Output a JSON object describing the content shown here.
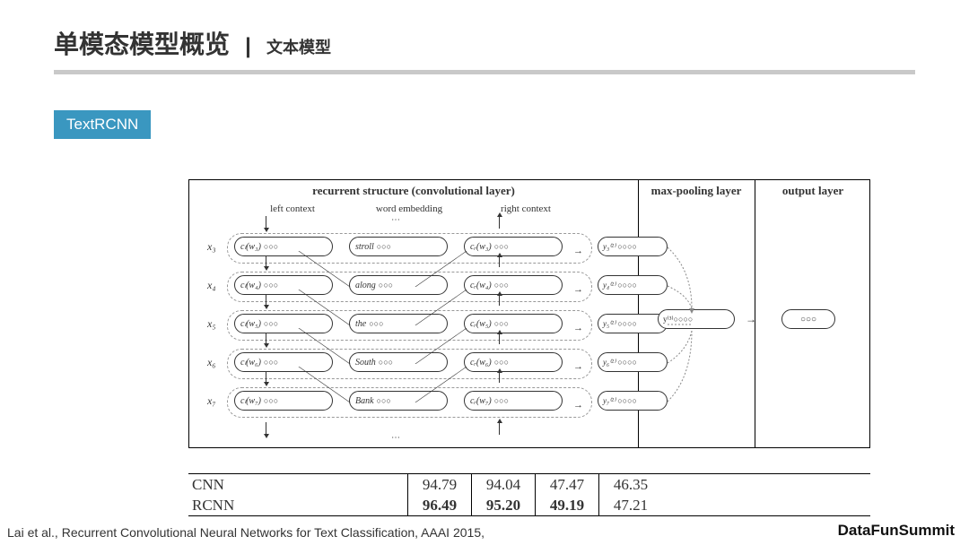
{
  "title": {
    "main": "单模态模型概览",
    "sub": "文本模型"
  },
  "badge": "TextRCNN",
  "figure": {
    "headers": {
      "recurrent": "recurrent structure (convolutional layer)",
      "pool": "max-pooling layer",
      "output": "output layer"
    },
    "subheads": {
      "left": "left context",
      "word": "word embedding",
      "right": "right context"
    },
    "pool_label": "y⁽³⁾",
    "rows": [
      {
        "x": "x₃",
        "cl": "cₗ(w₃)",
        "w": "stroll",
        "cr": "cᵣ(w₃)",
        "y": "y₃⁽²⁾"
      },
      {
        "x": "x₄",
        "cl": "cₗ(w₄)",
        "w": "along",
        "cr": "cᵣ(w₄)",
        "y": "y₄⁽²⁾"
      },
      {
        "x": "x₅",
        "cl": "cₗ(w₅)",
        "w": "the",
        "cr": "cᵣ(w₅)",
        "y": "y₅⁽²⁾"
      },
      {
        "x": "x₆",
        "cl": "cₗ(w₆)",
        "w": "South",
        "cr": "cᵣ(w₆)",
        "y": "y₆⁽²⁾"
      },
      {
        "x": "x₇",
        "cl": "cₗ(w₇)",
        "w": "Bank",
        "cr": "cᵣ(w₇)",
        "y": "y₇⁽²⁾"
      }
    ]
  },
  "table": {
    "rows": [
      {
        "model": "CNN",
        "v": [
          "94.79",
          "94.04",
          "47.47",
          "46.35"
        ]
      },
      {
        "model": "RCNN",
        "v": [
          "96.49",
          "95.20",
          "49.19",
          "47.21"
        ]
      }
    ]
  },
  "citation": "Lai et al., Recurrent Convolutional Neural Networks for Text Classification, AAAI 2015,",
  "logo": "DataFunSummit"
}
